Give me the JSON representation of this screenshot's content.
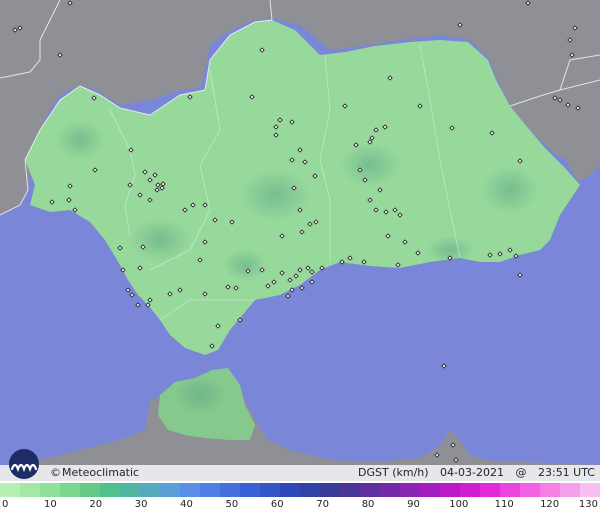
{
  "map": {
    "region": "Andalucía",
    "colors": {
      "sea": "#7a86d8",
      "land_outside": "#8f9095",
      "data_land": "#97d89b",
      "data_land_dark": "#6fbd7a",
      "border": "#ffffff",
      "station_marker": "#1b1b1b"
    },
    "station_marker_icon": "diamond-icon"
  },
  "branding": {
    "copyright_symbol": "©",
    "name": "Meteoclimatic",
    "logo_icon": "meteoclimatic-logo-icon"
  },
  "caption": {
    "variable": "DGST (km/h)",
    "date": "04-03-2021",
    "at": "@",
    "time": "23:51 UTC"
  },
  "legend": {
    "unit": "km/h",
    "ticks": [
      "0",
      "10",
      "20",
      "30",
      "40",
      "50",
      "60",
      "70",
      "80",
      "90",
      "100",
      "110",
      "120",
      "130"
    ],
    "colors": [
      "#b4f0b4",
      "#a3e8a6",
      "#8fe09a",
      "#79d68e",
      "#63cb86",
      "#52c08a",
      "#4fb6a0",
      "#55aac0",
      "#5b9fd8",
      "#5b8ee6",
      "#4f7ee6",
      "#4470e0",
      "#3a62d6",
      "#3355c8",
      "#2f49b8",
      "#3042a6",
      "#3a3a9a",
      "#4a3696",
      "#5e2f9e",
      "#742aa8",
      "#8c24b4",
      "#a41ebe",
      "#bc1ac8",
      "#d21cd2",
      "#e22ad8",
      "#ec44dc",
      "#f262e2",
      "#f480e6",
      "#f6a0ec",
      "#f8c0f2"
    ]
  }
}
